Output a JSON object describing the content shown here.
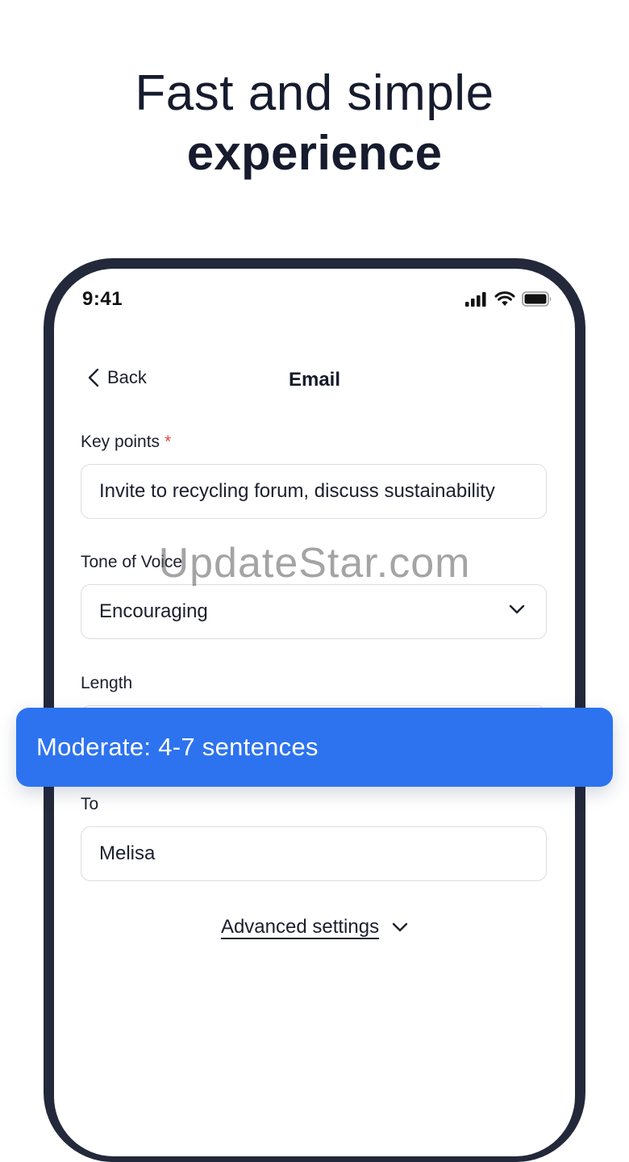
{
  "headline": {
    "line1": "Fast and simple",
    "line2": "experience"
  },
  "status_bar": {
    "time": "9:41",
    "icons": [
      "cellular-signal-icon",
      "wifi-icon",
      "battery-icon"
    ]
  },
  "nav": {
    "back_label": "Back",
    "title": "Email"
  },
  "form": {
    "key_points": {
      "label": "Key points",
      "required_marker": "*",
      "value": "Invite to recycling forum, discuss sustainability"
    },
    "tone_of_voice": {
      "label": "Tone of Voice",
      "selected": "Encouraging"
    },
    "length": {
      "label": "Length",
      "selected": "Moderate: 4-7 sentences"
    },
    "to": {
      "label": "To",
      "value": "Melisa"
    },
    "advanced_settings_label": "Advanced settings"
  },
  "watermark": "UpdateStar.com",
  "colors": {
    "accent": "#2d73ef",
    "phone_frame": "#23283a",
    "required": "#e5473e",
    "text": "#151a2b"
  }
}
